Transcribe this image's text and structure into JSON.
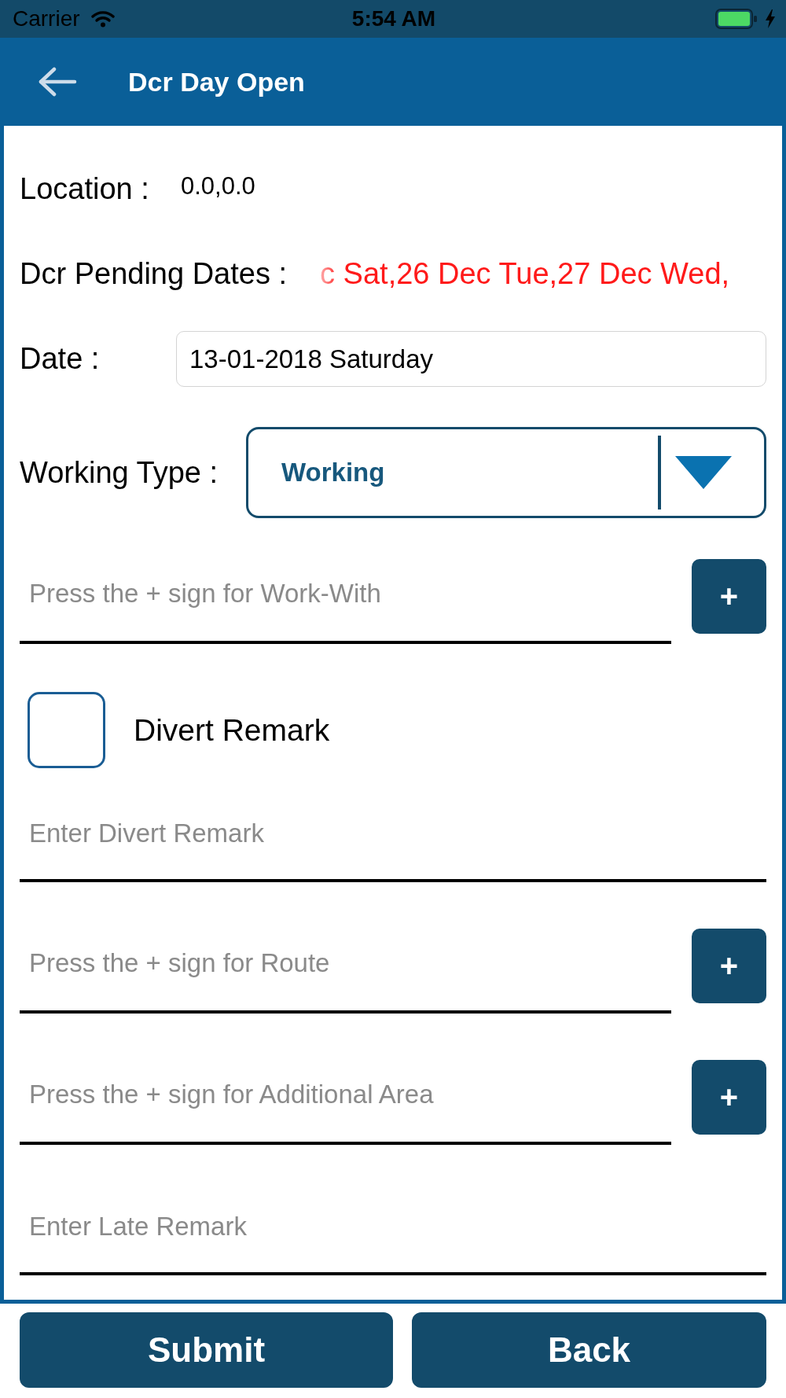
{
  "status_bar": {
    "carrier": "Carrier",
    "time": "5:54 AM"
  },
  "header": {
    "title": "Dcr Day Open"
  },
  "form": {
    "location": {
      "label": "Location :",
      "value": "0.0,0.0"
    },
    "pending_dates": {
      "label": "Dcr Pending Dates :",
      "value": "c Sat,26 Dec Tue,27 Dec Wed,"
    },
    "date": {
      "label": "Date :",
      "value": "13-01-2018 Saturday"
    },
    "working_type": {
      "label": "Working Type :",
      "value": "Working"
    },
    "fields": [
      {
        "kind": "picker",
        "placeholder": "Press the + sign for Work-With",
        "button": "+"
      },
      {
        "kind": "checkbox",
        "label": "Divert Remark",
        "checked": false
      },
      {
        "kind": "text",
        "placeholder": "Enter Divert Remark"
      },
      {
        "kind": "picker",
        "placeholder": "Press the + sign for Route",
        "button": "+"
      },
      {
        "kind": "picker",
        "placeholder": "Press the + sign for Additional Area",
        "button": "+"
      },
      {
        "kind": "text",
        "placeholder": "Enter Late Remark"
      }
    ]
  },
  "buttons": [
    "Submit",
    "Back"
  ]
}
